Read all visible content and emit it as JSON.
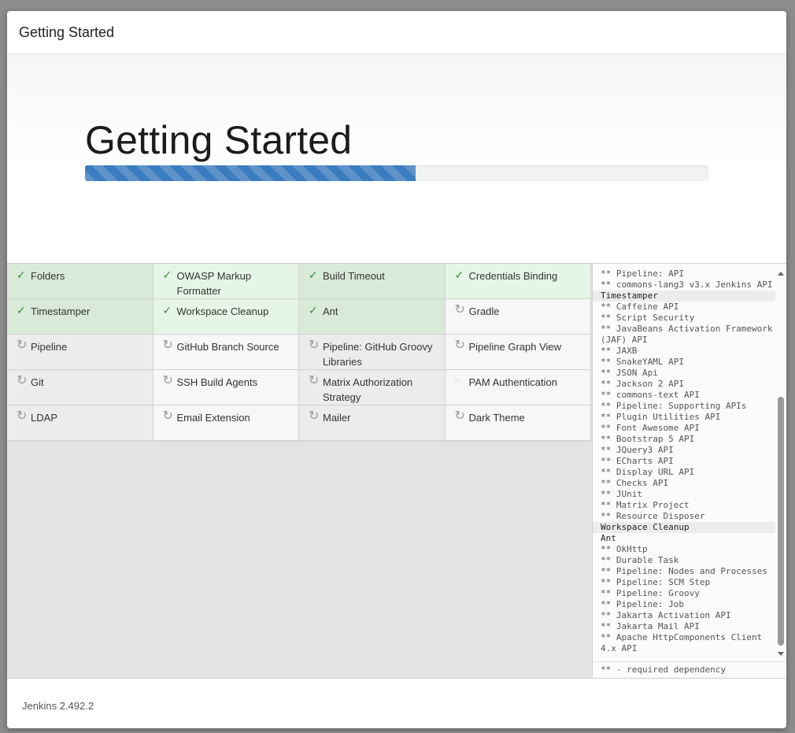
{
  "header": {
    "title": "Getting Started"
  },
  "hero": {
    "title": "Getting Started",
    "progress": 0.53
  },
  "plugins": [
    {
      "name": "Folders",
      "status": "success",
      "icon": "check-icon",
      "alt": false
    },
    {
      "name": "OWASP Markup Formatter",
      "status": "success",
      "icon": "check-icon",
      "alt": true
    },
    {
      "name": "Build Timeout",
      "status": "success",
      "icon": "check-icon",
      "alt": false
    },
    {
      "name": "Credentials Binding",
      "status": "success",
      "icon": "check-icon",
      "alt": true
    },
    {
      "name": "Timestamper",
      "status": "success",
      "icon": "check-icon",
      "alt": false
    },
    {
      "name": "Workspace Cleanup",
      "status": "success",
      "icon": "check-icon",
      "alt": true
    },
    {
      "name": "Ant",
      "status": "success",
      "icon": "check-icon",
      "alt": false
    },
    {
      "name": "Gradle",
      "status": "pending",
      "icon": "refresh-icon",
      "alt": true
    },
    {
      "name": "Pipeline",
      "status": "pending",
      "icon": "refresh-icon",
      "alt": false
    },
    {
      "name": "GitHub Branch Source",
      "status": "pending",
      "icon": "refresh-icon",
      "alt": true
    },
    {
      "name": "Pipeline: GitHub Groovy Libraries",
      "status": "pending",
      "icon": "refresh-icon",
      "alt": false
    },
    {
      "name": "Pipeline Graph View",
      "status": "pending",
      "icon": "refresh-icon",
      "alt": true
    },
    {
      "name": "Git",
      "status": "pending",
      "icon": "refresh-icon",
      "alt": false
    },
    {
      "name": "SSH Build Agents",
      "status": "pending",
      "icon": "refresh-icon",
      "alt": true
    },
    {
      "name": "Matrix Authorization Strategy",
      "status": "pending",
      "icon": "refresh-icon",
      "alt": false
    },
    {
      "name": "PAM Authentication",
      "status": "pending",
      "icon": "circle-icon",
      "alt": true
    },
    {
      "name": "LDAP",
      "status": "pending",
      "icon": "refresh-icon",
      "alt": false
    },
    {
      "name": "Email Extension",
      "status": "pending",
      "icon": "refresh-icon",
      "alt": true
    },
    {
      "name": "Mailer",
      "status": "pending",
      "icon": "refresh-icon",
      "alt": false
    },
    {
      "name": "Dark Theme",
      "status": "pending",
      "icon": "refresh-icon",
      "alt": true
    }
  ],
  "log": [
    {
      "text": "** Pipeline: API",
      "type": "dep"
    },
    {
      "text": "** commons-lang3 v3.x Jenkins API",
      "type": "dep"
    },
    {
      "text": "Timestamper",
      "type": "plugin"
    },
    {
      "text": "** Caffeine API",
      "type": "dep"
    },
    {
      "text": "** Script Security",
      "type": "dep"
    },
    {
      "text": "** JavaBeans Activation Framework (JAF) API",
      "type": "dep"
    },
    {
      "text": "** JAXB",
      "type": "dep"
    },
    {
      "text": "** SnakeYAML API",
      "type": "dep"
    },
    {
      "text": "** JSON Api",
      "type": "dep"
    },
    {
      "text": "** Jackson 2 API",
      "type": "dep"
    },
    {
      "text": "** commons-text API",
      "type": "dep"
    },
    {
      "text": "** Pipeline: Supporting APIs",
      "type": "dep"
    },
    {
      "text": "** Plugin Utilities API",
      "type": "dep"
    },
    {
      "text": "** Font Awesome API",
      "type": "dep"
    },
    {
      "text": "** Bootstrap 5 API",
      "type": "dep"
    },
    {
      "text": "** JQuery3 API",
      "type": "dep"
    },
    {
      "text": "** ECharts API",
      "type": "dep"
    },
    {
      "text": "** Display URL API",
      "type": "dep"
    },
    {
      "text": "** Checks API",
      "type": "dep"
    },
    {
      "text": "** JUnit",
      "type": "dep"
    },
    {
      "text": "** Matrix Project",
      "type": "dep"
    },
    {
      "text": "** Resource Disposer",
      "type": "dep"
    },
    {
      "text": "Workspace Cleanup",
      "type": "plugin"
    },
    {
      "text": "Ant",
      "type": "plugin-plain"
    },
    {
      "text": "** OkHttp",
      "type": "dep"
    },
    {
      "text": "** Durable Task",
      "type": "dep"
    },
    {
      "text": "** Pipeline: Nodes and Processes",
      "type": "dep"
    },
    {
      "text": "** Pipeline: SCM Step",
      "type": "dep"
    },
    {
      "text": "** Pipeline: Groovy",
      "type": "dep"
    },
    {
      "text": "** Pipeline: Job",
      "type": "dep"
    },
    {
      "text": "** Jakarta Activation API",
      "type": "dep"
    },
    {
      "text": "** Jakarta Mail API",
      "type": "dep"
    },
    {
      "text": "** Apache HttpComponents Client 4.x API",
      "type": "dep"
    }
  ],
  "log_footer": "** - required dependency",
  "footer": {
    "version": "Jenkins 2.492.2"
  }
}
